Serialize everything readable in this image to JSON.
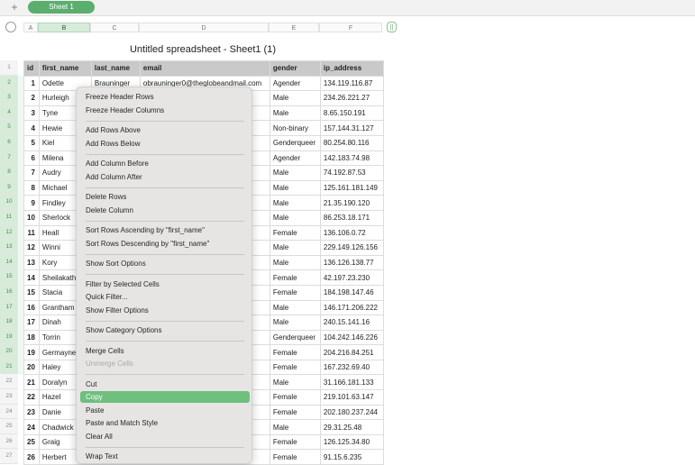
{
  "tabbar": {
    "add_label": "+",
    "sheet_tab": "Sheet 1"
  },
  "columns": [
    "A",
    "B",
    "C",
    "D",
    "E",
    "F"
  ],
  "column_toggle": "||",
  "sheet_title": "Untitled spreadsheet - Sheet1 (1)",
  "row_numbers": [
    "1",
    "2",
    "3",
    "4",
    "5",
    "6",
    "7",
    "8",
    "9",
    "10",
    "11",
    "12",
    "13",
    "14",
    "15",
    "16",
    "17",
    "18",
    "19",
    "20",
    "21",
    "22",
    "23",
    "24",
    "25",
    "26",
    "27"
  ],
  "table": {
    "headers": [
      "id",
      "first_name",
      "last_name",
      "email",
      "gender",
      "ip_address"
    ],
    "rows": [
      [
        "1",
        "Odette",
        "Brauninger",
        "obrauninger0@theglobeandmail.com",
        "Agender",
        "134.119.116.87"
      ],
      [
        "2",
        "Hurleigh",
        "",
        "",
        "Male",
        "234.26.221.27"
      ],
      [
        "3",
        "Tyne",
        "",
        "",
        "Male",
        "8.65.150.191"
      ],
      [
        "4",
        "Hewie",
        "",
        "",
        "Non-binary",
        "157.144.31.127"
      ],
      [
        "5",
        "Kiel",
        "",
        "",
        "Genderqueer",
        "80.254.80.116"
      ],
      [
        "6",
        "Milena",
        "",
        "",
        "Agender",
        "142.183.74.98"
      ],
      [
        "7",
        "Audry",
        "",
        "",
        "Male",
        "74.192.87.53"
      ],
      [
        "8",
        "Michael",
        "",
        "",
        "Male",
        "125.161.181.149"
      ],
      [
        "9",
        "Findley",
        "",
        "",
        "Male",
        "21.35.190.120"
      ],
      [
        "10",
        "Sherlock",
        "",
        "",
        "Male",
        "86.253.18.171"
      ],
      [
        "11",
        "Heall",
        "",
        "",
        "Female",
        "136.106.0.72"
      ],
      [
        "12",
        "Winni",
        "",
        "",
        "Male",
        "229.149.126.156"
      ],
      [
        "13",
        "Kory",
        "",
        "",
        "Male",
        "136.126.138.77"
      ],
      [
        "14",
        "Sheilakath",
        "",
        "",
        "Female",
        "42.197.23.230"
      ],
      [
        "15",
        "Stacia",
        "",
        "",
        "Female",
        "184.198.147.46"
      ],
      [
        "16",
        "Grantham",
        "",
        "",
        "Male",
        "146.171.206.222"
      ],
      [
        "17",
        "Dinah",
        "",
        "",
        "Male",
        "240.15.141.16"
      ],
      [
        "18",
        "Torrin",
        "",
        "",
        "Genderqueer",
        "104.242.146.226"
      ],
      [
        "19",
        "Germayne",
        "",
        "",
        "Female",
        "204.216.84.251"
      ],
      [
        "20",
        "Haley",
        "",
        "",
        "Female",
        "167.232.69.40"
      ],
      [
        "21",
        "Doralyn",
        "",
        "",
        "Male",
        "31.166.181.133"
      ],
      [
        "22",
        "Hazel",
        "",
        "",
        "Female",
        "219.101.63.147"
      ],
      [
        "23",
        "Danie",
        "",
        "",
        "Female",
        "202.180.237.244"
      ],
      [
        "24",
        "Chadwick",
        "",
        "",
        "Male",
        "29.31.25.48"
      ],
      [
        "25",
        "Graig",
        "",
        "",
        "Female",
        "126.125.34.80"
      ],
      [
        "26",
        "Herbert",
        "",
        "",
        "Female",
        "91.15.6.235"
      ]
    ]
  },
  "context_menu": {
    "items": [
      {
        "label": "Freeze Header Rows",
        "disabled": false,
        "highlighted": false
      },
      {
        "label": "Freeze Header Columns",
        "disabled": false,
        "highlighted": false
      },
      {
        "separator": true
      },
      {
        "label": "Add Rows Above",
        "disabled": false,
        "highlighted": false
      },
      {
        "label": "Add Rows Below",
        "disabled": false,
        "highlighted": false
      },
      {
        "separator": true
      },
      {
        "label": "Add Column Before",
        "disabled": false,
        "highlighted": false
      },
      {
        "label": "Add Column After",
        "disabled": false,
        "highlighted": false
      },
      {
        "separator": true
      },
      {
        "label": "Delete Rows",
        "disabled": false,
        "highlighted": false
      },
      {
        "label": "Delete Column",
        "disabled": false,
        "highlighted": false
      },
      {
        "separator": true
      },
      {
        "label": "Sort Rows Ascending by \"first_name\"",
        "disabled": false,
        "highlighted": false
      },
      {
        "label": "Sort Rows Descending by \"first_name\"",
        "disabled": false,
        "highlighted": false
      },
      {
        "separator": true
      },
      {
        "label": "Show Sort Options",
        "disabled": false,
        "highlighted": false
      },
      {
        "separator": true
      },
      {
        "label": "Filter by Selected Cells",
        "disabled": false,
        "highlighted": false
      },
      {
        "label": "Quick Filter...",
        "disabled": false,
        "highlighted": false
      },
      {
        "label": "Show Filter Options",
        "disabled": false,
        "highlighted": false
      },
      {
        "separator": true
      },
      {
        "label": "Show Category Options",
        "disabled": false,
        "highlighted": false
      },
      {
        "separator": true
      },
      {
        "label": "Merge Cells",
        "disabled": false,
        "highlighted": false
      },
      {
        "label": "Unmerge Cells",
        "disabled": true,
        "highlighted": false
      },
      {
        "separator": true
      },
      {
        "label": "Cut",
        "disabled": false,
        "highlighted": false
      },
      {
        "label": "Copy",
        "disabled": false,
        "highlighted": true
      },
      {
        "label": "Paste",
        "disabled": false,
        "highlighted": false
      },
      {
        "label": "Paste and Match Style",
        "disabled": false,
        "highlighted": false
      },
      {
        "label": "Clear All",
        "disabled": false,
        "highlighted": false
      },
      {
        "separator": true
      },
      {
        "label": "Wrap Text",
        "disabled": false,
        "highlighted": false
      }
    ]
  },
  "colors": {
    "accent": "#5cae6e",
    "menu_highlight": "#6fbf7f",
    "header_row": "#c9c9c9",
    "selection": "#d6ecd9"
  }
}
